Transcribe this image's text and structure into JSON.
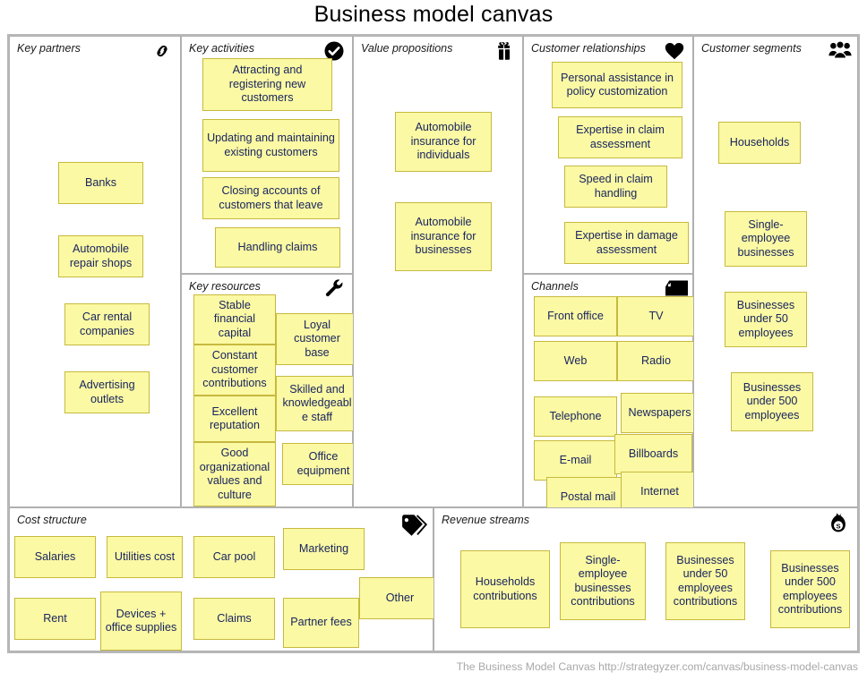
{
  "title": "Business model canvas",
  "footer": "The Business Model Canvas http://strategyzer.com/canvas/business-model-canvas",
  "colors": {
    "note_fill": "#fbf9a3",
    "note_border": "#c7b93f",
    "note_text": "#1a2560",
    "panel_border": "#b0b0b0",
    "frame_border": "#b8b8b8",
    "footer_text": "#a8a8a8"
  },
  "sections": {
    "key_partners": {
      "title": "Key partners",
      "icon": "chain-link-icon",
      "notes": [
        {
          "label": "Banks"
        },
        {
          "label": "Automobile repair shops"
        },
        {
          "label": "Car rental companies"
        },
        {
          "label": "Advertising outlets"
        }
      ]
    },
    "key_activities": {
      "title": "Key activities",
      "icon": "check-circle-icon",
      "notes": [
        {
          "label": "Attracting and registering new customers"
        },
        {
          "label": "Updating and maintaining existing customers"
        },
        {
          "label": "Closing accounts of customers that leave"
        },
        {
          "label": "Handling claims"
        }
      ]
    },
    "key_resources": {
      "title": "Key resources",
      "icon": "wrench-icon",
      "notes": [
        {
          "label": "Stable financial capital"
        },
        {
          "label": "Constant customer contributions"
        },
        {
          "label": "Excellent reputation"
        },
        {
          "label": "Good organizational values and culture"
        },
        {
          "label": "Loyal customer base"
        },
        {
          "label": "Skilled and knowledgeabl e staff"
        },
        {
          "label": "Office equipment"
        }
      ]
    },
    "value_propositions": {
      "title": "Value propositions",
      "icon": "gift-icon",
      "notes": [
        {
          "label": "Automobile insurance for individuals"
        },
        {
          "label": "Automobile insurance for businesses"
        }
      ]
    },
    "customer_relationships": {
      "title": "Customer relationships",
      "icon": "heart-icon",
      "notes": [
        {
          "label": "Personal assistance in policy customization"
        },
        {
          "label": "Expertise in claim assessment"
        },
        {
          "label": "Speed in claim handling"
        },
        {
          "label": "Expertise in damage assessment"
        }
      ]
    },
    "channels": {
      "title": "Channels",
      "icon": "truck-icon",
      "notes": [
        {
          "label": "Front office"
        },
        {
          "label": "TV"
        },
        {
          "label": "Web"
        },
        {
          "label": "Radio"
        },
        {
          "label": "Telephone"
        },
        {
          "label": "Newspapers"
        },
        {
          "label": "E-mail"
        },
        {
          "label": "Billboards"
        },
        {
          "label": "Postal mail"
        },
        {
          "label": "Internet"
        }
      ]
    },
    "customer_segments": {
      "title": "Customer segments",
      "icon": "people-group-icon",
      "notes": [
        {
          "label": "Households"
        },
        {
          "label": "Single-employee businesses"
        },
        {
          "label": "Businesses under 50 employees"
        },
        {
          "label": "Businesses under 500 employees"
        }
      ]
    },
    "cost_structure": {
      "title": "Cost structure",
      "icon": "price-tag-icon",
      "notes": [
        {
          "label": "Salaries"
        },
        {
          "label": "Utilities cost"
        },
        {
          "label": "Car pool"
        },
        {
          "label": "Marketing"
        },
        {
          "label": "Other"
        },
        {
          "label": "Rent"
        },
        {
          "label": "Devices + office supplies"
        },
        {
          "label": "Claims"
        },
        {
          "label": "Partner fees"
        }
      ]
    },
    "revenue_streams": {
      "title": "Revenue streams",
      "icon": "money-bag-icon",
      "notes": [
        {
          "label": "Households contributions"
        },
        {
          "label": "Single-employee businesses contributions"
        },
        {
          "label": "Businesses under 50 employees contributions"
        },
        {
          "label": "Businesses under 500 employees contributions"
        }
      ]
    }
  }
}
